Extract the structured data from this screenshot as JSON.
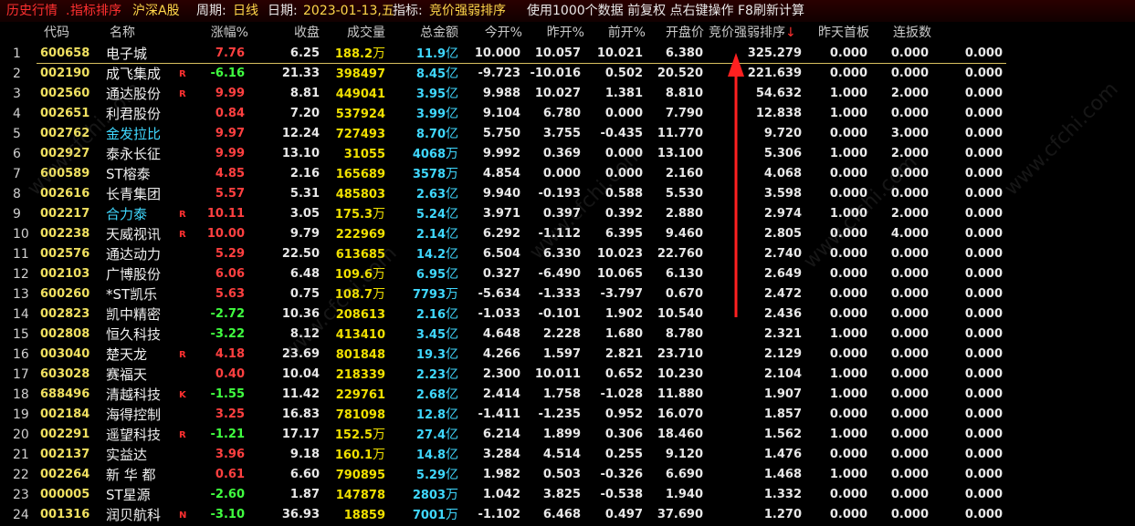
{
  "titlebar": {
    "history": "历史行情",
    "sep": ".",
    "indicator_sort": "指标排序",
    "market": "沪深A股",
    "period_label": "周期:",
    "period_value": "日线",
    "date_label": "日期:",
    "date_value": "2023-01-13,五",
    "indicator_label": "指标:",
    "indicator_value": "竞价强弱排序",
    "info": "使用1000个数据 前复权 点右键操作 F8刷新计算"
  },
  "columns": [
    "代码",
    "名称",
    "涨幅%",
    "收盘",
    "成交量",
    "总金额",
    "今开%",
    "昨开%",
    "前开%",
    "开盘价",
    "竞价强弱排序",
    "昨天首板",
    "连扳数"
  ],
  "sort_arrow": "↓",
  "rows": [
    {
      "idx": "1",
      "code": "600658",
      "name": "电子城",
      "name_color": "white",
      "flag": "",
      "chg": "7.76",
      "dir": "up",
      "close": "6.25",
      "vol": "188.2",
      "vol_unit": "万",
      "amt": "11.9",
      "amt_unit": "亿",
      "open_today": "10.000",
      "open_yest": "10.057",
      "open_prev": "10.021",
      "open_price": "6.380",
      "score": "325.279",
      "first_board": "0.000",
      "streak": "0.000",
      "last": "0.000"
    },
    {
      "idx": "2",
      "code": "002190",
      "name": "成飞集成",
      "name_color": "white",
      "flag": "R",
      "chg": "-6.16",
      "dir": "down",
      "close": "21.33",
      "vol": "398497",
      "vol_unit": "",
      "amt": "8.45",
      "amt_unit": "亿",
      "open_today": "-9.723",
      "open_yest": "-10.016",
      "open_prev": "0.502",
      "open_price": "20.520",
      "score": "221.639",
      "first_board": "0.000",
      "streak": "0.000",
      "last": "0.000"
    },
    {
      "idx": "3",
      "code": "002560",
      "name": "通达股份",
      "name_color": "white",
      "flag": "R",
      "chg": "9.99",
      "dir": "up",
      "close": "8.81",
      "vol": "449041",
      "vol_unit": "",
      "amt": "3.95",
      "amt_unit": "亿",
      "open_today": "9.988",
      "open_yest": "10.027",
      "open_prev": "1.381",
      "open_price": "8.810",
      "score": "54.632",
      "first_board": "1.000",
      "streak": "2.000",
      "last": "0.000"
    },
    {
      "idx": "4",
      "code": "002651",
      "name": "利君股份",
      "name_color": "white",
      "flag": "",
      "chg": "0.84",
      "dir": "up",
      "close": "7.20",
      "vol": "537924",
      "vol_unit": "",
      "amt": "3.99",
      "amt_unit": "亿",
      "open_today": "9.104",
      "open_yest": "6.780",
      "open_prev": "0.000",
      "open_price": "7.790",
      "score": "12.838",
      "first_board": "1.000",
      "streak": "0.000",
      "last": "0.000"
    },
    {
      "idx": "5",
      "code": "002762",
      "name": "金发拉比",
      "name_color": "cyan",
      "flag": "",
      "chg": "9.97",
      "dir": "up",
      "close": "12.24",
      "vol": "727493",
      "vol_unit": "",
      "amt": "8.70",
      "amt_unit": "亿",
      "open_today": "5.750",
      "open_yest": "3.755",
      "open_prev": "-0.435",
      "open_price": "11.770",
      "score": "9.720",
      "first_board": "0.000",
      "streak": "3.000",
      "last": "0.000"
    },
    {
      "idx": "6",
      "code": "002927",
      "name": "泰永长征",
      "name_color": "white",
      "flag": "",
      "chg": "9.99",
      "dir": "up",
      "close": "13.10",
      "vol": "31055",
      "vol_unit": "",
      "amt": "4068",
      "amt_unit": "万",
      "open_today": "9.992",
      "open_yest": "0.369",
      "open_prev": "0.000",
      "open_price": "13.100",
      "score": "5.306",
      "first_board": "1.000",
      "streak": "2.000",
      "last": "0.000"
    },
    {
      "idx": "7",
      "code": "600589",
      "name": "ST榕泰",
      "name_color": "white",
      "flag": "",
      "chg": "4.85",
      "dir": "up",
      "close": "2.16",
      "vol": "165689",
      "vol_unit": "",
      "amt": "3578",
      "amt_unit": "万",
      "open_today": "4.854",
      "open_yest": "0.000",
      "open_prev": "0.000",
      "open_price": "2.160",
      "score": "4.068",
      "first_board": "0.000",
      "streak": "0.000",
      "last": "0.000"
    },
    {
      "idx": "8",
      "code": "002616",
      "name": "长青集团",
      "name_color": "white",
      "flag": "",
      "chg": "5.57",
      "dir": "up",
      "close": "5.31",
      "vol": "485803",
      "vol_unit": "",
      "amt": "2.63",
      "amt_unit": "亿",
      "open_today": "9.940",
      "open_yest": "-0.193",
      "open_prev": "0.588",
      "open_price": "5.530",
      "score": "3.598",
      "first_board": "0.000",
      "streak": "0.000",
      "last": "0.000"
    },
    {
      "idx": "9",
      "code": "002217",
      "name": "合力泰",
      "name_color": "cyan",
      "flag": "R",
      "chg": "10.11",
      "dir": "up",
      "close": "3.05",
      "vol": "175.3",
      "vol_unit": "万",
      "amt": "5.24",
      "amt_unit": "亿",
      "open_today": "3.971",
      "open_yest": "0.397",
      "open_prev": "0.392",
      "open_price": "2.880",
      "score": "2.974",
      "first_board": "1.000",
      "streak": "2.000",
      "last": "0.000"
    },
    {
      "idx": "10",
      "code": "002238",
      "name": "天威视讯",
      "name_color": "white",
      "flag": "R",
      "chg": "10.00",
      "dir": "up",
      "close": "9.79",
      "vol": "222969",
      "vol_unit": "",
      "amt": "2.14",
      "amt_unit": "亿",
      "open_today": "6.292",
      "open_yest": "-1.112",
      "open_prev": "6.395",
      "open_price": "9.460",
      "score": "2.805",
      "first_board": "0.000",
      "streak": "4.000",
      "last": "0.000"
    },
    {
      "idx": "11",
      "code": "002576",
      "name": "通达动力",
      "name_color": "white",
      "flag": "",
      "chg": "5.29",
      "dir": "up",
      "close": "22.50",
      "vol": "613685",
      "vol_unit": "",
      "amt": "14.2",
      "amt_unit": "亿",
      "open_today": "6.504",
      "open_yest": "6.330",
      "open_prev": "10.023",
      "open_price": "22.760",
      "score": "2.740",
      "first_board": "0.000",
      "streak": "0.000",
      "last": "0.000"
    },
    {
      "idx": "12",
      "code": "002103",
      "name": "广博股份",
      "name_color": "white",
      "flag": "",
      "chg": "6.06",
      "dir": "up",
      "close": "6.48",
      "vol": "109.6",
      "vol_unit": "万",
      "amt": "6.95",
      "amt_unit": "亿",
      "open_today": "0.327",
      "open_yest": "-6.490",
      "open_prev": "10.065",
      "open_price": "6.130",
      "score": "2.649",
      "first_board": "0.000",
      "streak": "0.000",
      "last": "0.000"
    },
    {
      "idx": "13",
      "code": "600260",
      "name": "*ST凯乐",
      "name_color": "white",
      "flag": "",
      "chg": "5.63",
      "dir": "up",
      "close": "0.75",
      "vol": "108.7",
      "vol_unit": "万",
      "amt": "7793",
      "amt_unit": "万",
      "open_today": "-5.634",
      "open_yest": "-1.333",
      "open_prev": "-3.797",
      "open_price": "0.670",
      "score": "2.472",
      "first_board": "0.000",
      "streak": "0.000",
      "last": "0.000"
    },
    {
      "idx": "14",
      "code": "002823",
      "name": "凯中精密",
      "name_color": "white",
      "flag": "",
      "chg": "-2.72",
      "dir": "down",
      "close": "10.36",
      "vol": "208613",
      "vol_unit": "",
      "amt": "2.16",
      "amt_unit": "亿",
      "open_today": "-1.033",
      "open_yest": "-0.101",
      "open_prev": "1.902",
      "open_price": "10.540",
      "score": "2.436",
      "first_board": "0.000",
      "streak": "0.000",
      "last": "0.000"
    },
    {
      "idx": "15",
      "code": "002808",
      "name": "恒久科技",
      "name_color": "white",
      "flag": "",
      "chg": "-3.22",
      "dir": "down",
      "close": "8.12",
      "vol": "413410",
      "vol_unit": "",
      "amt": "3.45",
      "amt_unit": "亿",
      "open_today": "4.648",
      "open_yest": "2.228",
      "open_prev": "1.680",
      "open_price": "8.780",
      "score": "2.321",
      "first_board": "1.000",
      "streak": "0.000",
      "last": "0.000"
    },
    {
      "idx": "16",
      "code": "003040",
      "name": "楚天龙",
      "name_color": "white",
      "flag": "R",
      "chg": "4.18",
      "dir": "up",
      "close": "23.69",
      "vol": "801848",
      "vol_unit": "",
      "amt": "19.3",
      "amt_unit": "亿",
      "open_today": "4.266",
      "open_yest": "1.597",
      "open_prev": "2.821",
      "open_price": "23.710",
      "score": "2.129",
      "first_board": "0.000",
      "streak": "0.000",
      "last": "0.000"
    },
    {
      "idx": "17",
      "code": "603028",
      "name": "赛福天",
      "name_color": "white",
      "flag": "",
      "chg": "0.40",
      "dir": "up",
      "close": "10.04",
      "vol": "218339",
      "vol_unit": "",
      "amt": "2.23",
      "amt_unit": "亿",
      "open_today": "2.300",
      "open_yest": "10.011",
      "open_prev": "0.652",
      "open_price": "10.230",
      "score": "2.104",
      "first_board": "1.000",
      "streak": "0.000",
      "last": "0.000"
    },
    {
      "idx": "18",
      "code": "688496",
      "name": "清越科技",
      "name_color": "white",
      "flag": "K",
      "chg": "-1.55",
      "dir": "down",
      "close": "11.42",
      "vol": "229761",
      "vol_unit": "",
      "amt": "2.68",
      "amt_unit": "亿",
      "open_today": "2.414",
      "open_yest": "1.758",
      "open_prev": "-1.028",
      "open_price": "11.880",
      "score": "1.907",
      "first_board": "1.000",
      "streak": "0.000",
      "last": "0.000"
    },
    {
      "idx": "19",
      "code": "002184",
      "name": "海得控制",
      "name_color": "white",
      "flag": "",
      "chg": "3.25",
      "dir": "up",
      "close": "16.83",
      "vol": "781098",
      "vol_unit": "",
      "amt": "12.8",
      "amt_unit": "亿",
      "open_today": "-1.411",
      "open_yest": "-1.235",
      "open_prev": "0.952",
      "open_price": "16.070",
      "score": "1.857",
      "first_board": "0.000",
      "streak": "0.000",
      "last": "0.000"
    },
    {
      "idx": "20",
      "code": "002291",
      "name": "遥望科技",
      "name_color": "white",
      "flag": "R",
      "chg": "-1.21",
      "dir": "down",
      "close": "17.17",
      "vol": "152.5",
      "vol_unit": "万",
      "amt": "27.4",
      "amt_unit": "亿",
      "open_today": "6.214",
      "open_yest": "1.899",
      "open_prev": "0.306",
      "open_price": "18.460",
      "score": "1.562",
      "first_board": "1.000",
      "streak": "0.000",
      "last": "0.000"
    },
    {
      "idx": "21",
      "code": "002137",
      "name": "实益达",
      "name_color": "white",
      "flag": "",
      "chg": "3.96",
      "dir": "up",
      "close": "9.18",
      "vol": "160.1",
      "vol_unit": "万",
      "amt": "14.8",
      "amt_unit": "亿",
      "open_today": "3.284",
      "open_yest": "4.514",
      "open_prev": "0.255",
      "open_price": "9.120",
      "score": "1.476",
      "first_board": "0.000",
      "streak": "0.000",
      "last": "0.000"
    },
    {
      "idx": "22",
      "code": "002264",
      "name": "新 华 都",
      "name_color": "white",
      "flag": "",
      "chg": "0.61",
      "dir": "up",
      "close": "6.60",
      "vol": "790895",
      "vol_unit": "",
      "amt": "5.29",
      "amt_unit": "亿",
      "open_today": "1.982",
      "open_yest": "0.503",
      "open_prev": "-0.326",
      "open_price": "6.690",
      "score": "1.468",
      "first_board": "1.000",
      "streak": "0.000",
      "last": "0.000"
    },
    {
      "idx": "23",
      "code": "000005",
      "name": "ST星源",
      "name_color": "white",
      "flag": "",
      "chg": "-2.60",
      "dir": "down",
      "close": "1.87",
      "vol": "147878",
      "vol_unit": "",
      "amt": "2803",
      "amt_unit": "万",
      "open_today": "1.042",
      "open_yest": "3.825",
      "open_prev": "-0.538",
      "open_price": "1.940",
      "score": "1.332",
      "first_board": "0.000",
      "streak": "0.000",
      "last": "0.000"
    },
    {
      "idx": "24",
      "code": "001316",
      "name": "润贝航科",
      "name_color": "white",
      "flag": "N",
      "chg": "-3.10",
      "dir": "down",
      "close": "36.93",
      "vol": "18859",
      "vol_unit": "",
      "amt": "7001",
      "amt_unit": "万",
      "open_today": "-1.102",
      "open_yest": "6.468",
      "open_prev": "0.497",
      "open_price": "37.690",
      "score": "1.270",
      "first_board": "0.000",
      "streak": "0.000",
      "last": "0.000"
    }
  ]
}
